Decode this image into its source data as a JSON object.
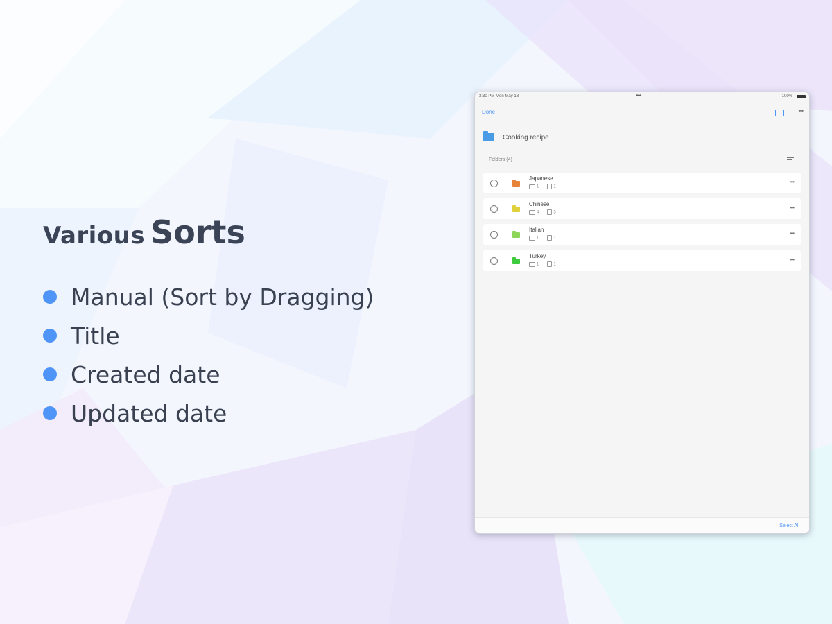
{
  "promo": {
    "headline_small": "Various",
    "headline_big": "Sorts",
    "features": [
      "Manual (Sort by Dragging)",
      "Title",
      "Created date",
      "Updated date"
    ]
  },
  "colors": {
    "accent": "#4f94f7",
    "text": "#3b4456"
  },
  "tablet": {
    "status": {
      "time": "3:30 PM  Mon May 18",
      "center": "•••",
      "right": "100%"
    },
    "nav": {
      "done_label": "Done",
      "add_icon": "new-folder-icon",
      "more_label": "•••"
    },
    "folder_title": "Cooking recipe",
    "section_label": "Folders  (4)",
    "folders": [
      {
        "name": "Japanese",
        "color": "#e8833a",
        "folders": "1",
        "notes": "1"
      },
      {
        "name": "Chinese",
        "color": "#e0d13b",
        "folders": "4",
        "notes": "3"
      },
      {
        "name": "Italian",
        "color": "#8ed65a",
        "folders": "1",
        "notes": "1"
      },
      {
        "name": "Turkey",
        "color": "#3ecb3e",
        "folders": "1",
        "notes": "1"
      }
    ],
    "select_all_label": "Select All"
  }
}
